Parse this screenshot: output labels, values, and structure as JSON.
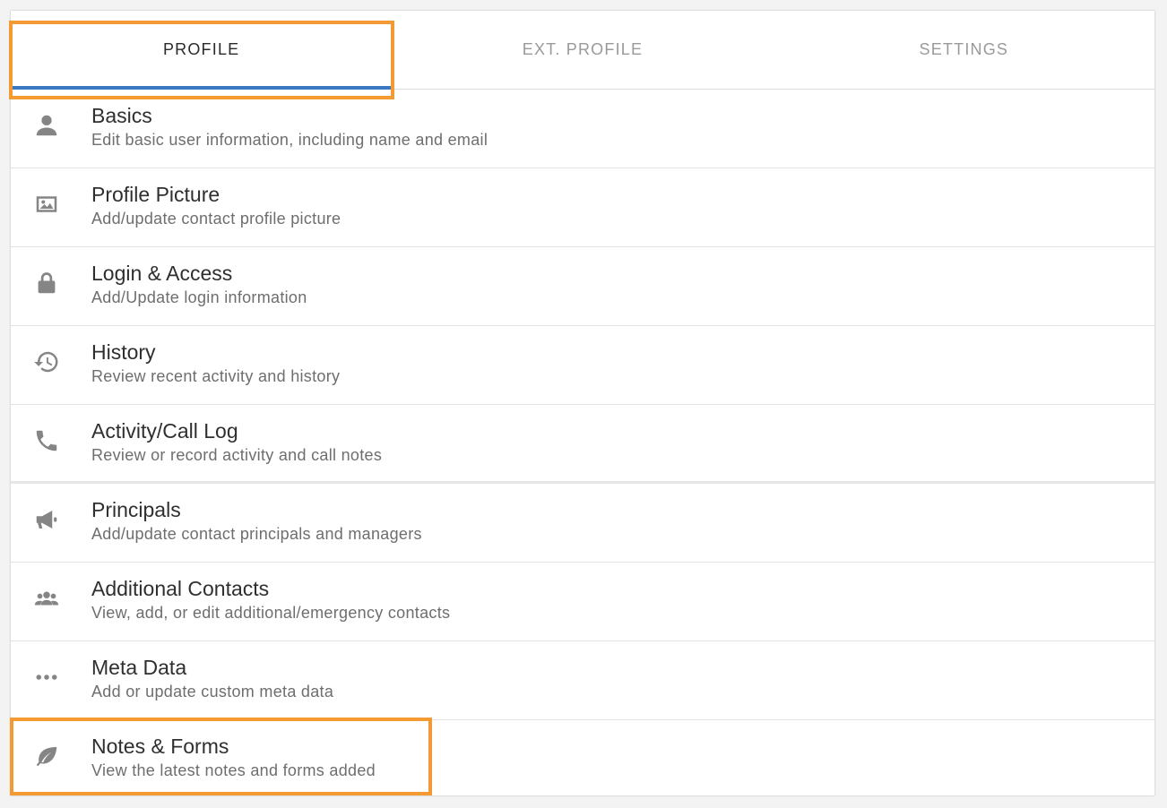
{
  "tabs": [
    {
      "label": "PROFILE",
      "active": true
    },
    {
      "label": "EXT. PROFILE",
      "active": false
    },
    {
      "label": "SETTINGS",
      "active": false
    }
  ],
  "items": [
    {
      "icon": "user-icon",
      "title": "Basics",
      "subtitle": "Edit basic user information, including name and email"
    },
    {
      "icon": "image-icon",
      "title": "Profile Picture",
      "subtitle": "Add/update contact profile picture"
    },
    {
      "icon": "lock-icon",
      "title": "Login & Access",
      "subtitle": "Add/Update login information"
    },
    {
      "icon": "history-icon",
      "title": "History",
      "subtitle": "Review recent activity and history"
    },
    {
      "icon": "phone-icon",
      "title": "Activity/Call Log",
      "subtitle": "Review or record activity and call notes"
    },
    {
      "icon": "megaphone-icon",
      "title": "Principals",
      "subtitle": "Add/update contact principals and managers"
    },
    {
      "icon": "group-icon",
      "title": "Additional Contacts",
      "subtitle": "View, add, or edit additional/emergency contacts"
    },
    {
      "icon": "more-dots-icon",
      "title": "Meta Data",
      "subtitle": "Add or update custom meta data"
    },
    {
      "icon": "leaf-icon",
      "title": "Notes & Forms",
      "subtitle": "View the latest notes and forms added"
    }
  ],
  "colors": {
    "accent": "#3c78c0",
    "highlight": "#f49a33",
    "icon": "#858585"
  }
}
